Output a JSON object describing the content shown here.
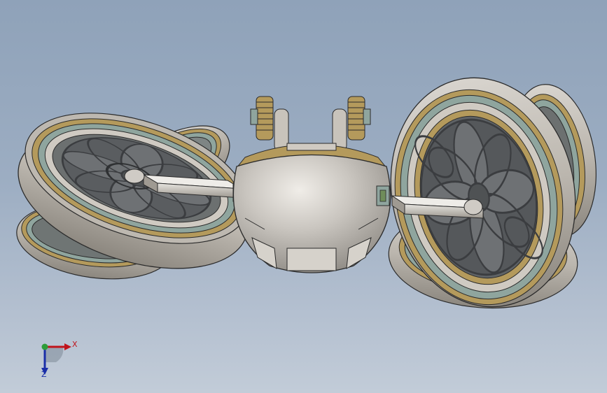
{
  "viewport": {
    "background_top": "#8fa2b9",
    "background_bottom": "#c2ccd8",
    "model_parts": [
      "left-wheel-assembly",
      "center-sphere-body",
      "right-wheel-assembly"
    ],
    "colors": {
      "rim_tan": "#b49a5c",
      "rim_steel": "#8fa59e",
      "body_gray": "#b8b4ad",
      "spoke_dark": "#56595c",
      "edge": "#2b2b2b"
    }
  },
  "triad": {
    "x_label": "X",
    "z_label": "Z",
    "x_color": "#c0141c",
    "z_color": "#1a2ea8",
    "origin_color": "#2e9d3a"
  }
}
